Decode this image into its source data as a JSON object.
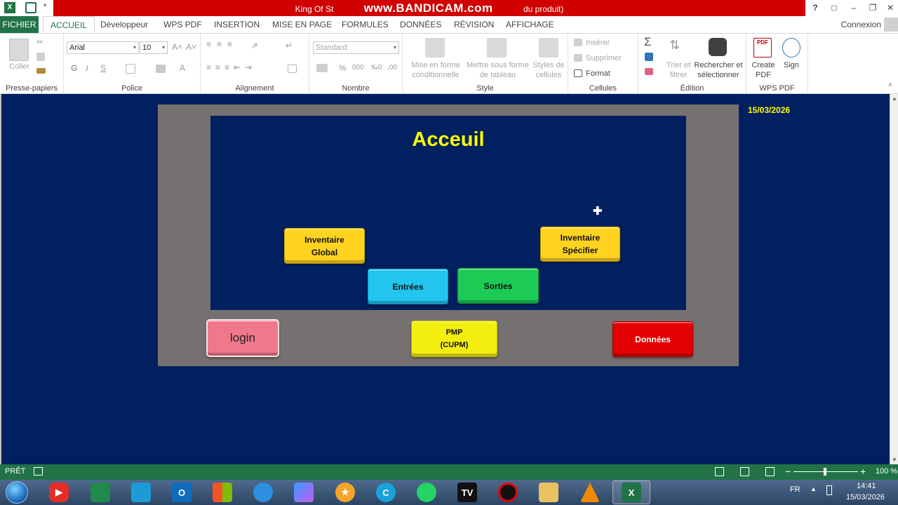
{
  "window": {
    "title_left": "King Of St",
    "title_brand": "www.BANDICAM.com",
    "title_right": "du produit)",
    "buttons": [
      "?",
      "□",
      "–",
      "❐",
      "✕"
    ]
  },
  "menu": {
    "tabs": [
      "FICHIER",
      "ACCUEIL",
      "Développeur",
      "WPS PDF",
      "INSERTION",
      "MISE EN PAGE",
      "FORMULES",
      "DONNÉES",
      "RÉVISION",
      "AFFICHAGE"
    ],
    "active": "ACCUEIL",
    "account": "Connexion"
  },
  "ribbon": {
    "clipboard": {
      "paste": "Coller",
      "label": "Presse-papiers"
    },
    "font": {
      "name": "Arial",
      "size": "10",
      "bold": "G",
      "italic": "I",
      "underline": "S",
      "grow": "A˄",
      "shrink": "A˅",
      "color": "A",
      "label": "Police"
    },
    "alignment": {
      "label": "Alignement"
    },
    "number": {
      "format": "Standard",
      "percent": "%",
      "thousands": "000",
      "dec_inc": "‰0",
      "dec_dec": ",00",
      "label": "Nombre"
    },
    "style": {
      "conditional": [
        "Mise en forme",
        "conditionnelle"
      ],
      "table": [
        "Mettre sous forme",
        "de tableau"
      ],
      "cell_styles": [
        "Styles de",
        "cellules"
      ],
      "label": "Style"
    },
    "cells": {
      "insert": "Insérer",
      "delete": "Supprimer",
      "format": "Format",
      "label": "Cellules"
    },
    "editing": {
      "sum": "Σ",
      "sort": [
        "Trier et",
        "filtrer"
      ],
      "find": [
        "Rechercher et",
        "sélectionner"
      ],
      "label": "Édition"
    },
    "wps": {
      "create": [
        "Create",
        "PDF"
      ],
      "sign": "Sign",
      "label": "WPS PDF"
    }
  },
  "sheet": {
    "date": "15/03/2026",
    "title": "Acceuil",
    "buttons": {
      "global": [
        "Inventaire",
        "Global"
      ],
      "specific": [
        "Inventaire",
        "Spécifier"
      ],
      "entries": "Entrées",
      "exits": "Sorties",
      "login": "login",
      "pmp": [
        "PMP",
        "(CUPM)"
      ],
      "data": "Données"
    }
  },
  "status": {
    "ready": "PRÊT",
    "zoom": "100 %"
  },
  "taskbar": {
    "lang": "FR",
    "time": "14:41",
    "date": "15/03/2026"
  },
  "colors": {
    "excel_green": "#217346",
    "sheet_bg": "#002060",
    "frame_gray": "#767171",
    "title_yellow": "#FFFF00",
    "recording_red": "#D00000"
  }
}
